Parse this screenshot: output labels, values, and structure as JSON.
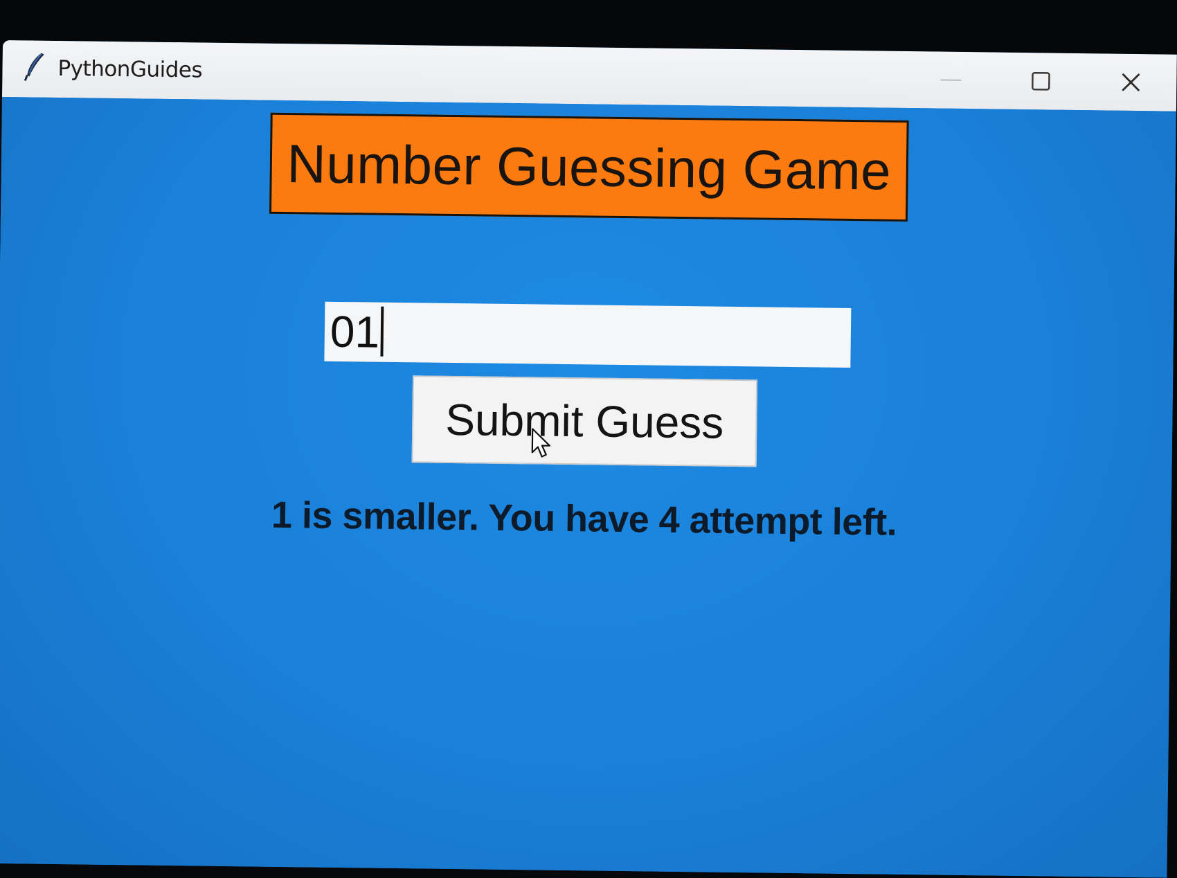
{
  "window": {
    "title": "PythonGuides",
    "controls": {
      "minimize": "minimize-icon",
      "maximize": "maximize-icon",
      "close": "close-icon"
    }
  },
  "game": {
    "title": "Number Guessing Game",
    "input_value": "01",
    "submit_label": "Submit Guess",
    "result_message": "1 is smaller. You have 4 attempt left."
  },
  "colors": {
    "background": "#1a80d8",
    "title_bg": "#fb7b10",
    "input_bg": "#f4f6f7",
    "button_bg": "#f3f3f3"
  }
}
